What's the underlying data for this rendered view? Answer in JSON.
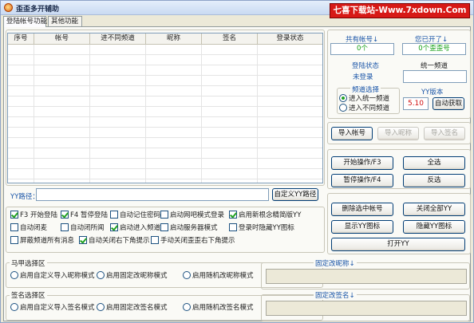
{
  "window": {
    "title": "歪歪多开辅助",
    "watermark": "七喜下载站-Www.7xdown.Com"
  },
  "tabs": [
    {
      "label": "登陆帐号功能"
    },
    {
      "label": "其他功能"
    }
  ],
  "grid": {
    "columns": [
      "序号",
      "帐号",
      "进不同频道",
      "昵称",
      "签名",
      "登录状态"
    ]
  },
  "yy_path": {
    "label": "YY路径：",
    "value": "",
    "button": "自定义YY路径"
  },
  "stats": {
    "total_label": "共有帐号↓",
    "total_value": "0个",
    "opened_label": "您已开了↓",
    "opened_value": "0个歪歪号",
    "login_status_label": "登陆状态",
    "login_status_value": "未登录",
    "channel_label": "统一频道",
    "channel_value": "",
    "channel_select_label": "频道选择",
    "channel_options": [
      {
        "label": "进入统一频道",
        "checked": true
      },
      {
        "label": "进入不同频道",
        "checked": false
      }
    ],
    "yy_version_label": "YY版本",
    "yy_version_value": "5.10",
    "auto_fetch": "自动获取"
  },
  "import": {
    "account": "导入帐号",
    "nickname": "导入昵称",
    "signature": "导入签名"
  },
  "ops": {
    "start": "开始操作/F3",
    "select_all": "全选",
    "pause": "暂停操作/F4",
    "invert": "反选"
  },
  "actions": {
    "delete_selected": "删除选中帐号",
    "close_all": "关闭全部YY",
    "show_icon": "显示YY图标",
    "hide_icon": "隐藏YY图标",
    "open": "打开YY"
  },
  "options": [
    {
      "label": "F3 开始登陆",
      "checked": true
    },
    {
      "label": "F4 暂停登陆",
      "checked": true
    },
    {
      "label": "自动记住密码",
      "checked": false
    },
    {
      "label": "启动网吧模式登录",
      "checked": false
    },
    {
      "label": "启用新根念精简版YY",
      "checked": true
    },
    {
      "label": "自动闭麦",
      "checked": false
    },
    {
      "label": "自动闭所闻",
      "checked": false
    },
    {
      "label": "启动进入频道",
      "checked": true
    },
    {
      "label": "启动服务器模式",
      "checked": false
    },
    {
      "label": "登录时隐藏YY图标",
      "checked": false
    },
    {
      "label": "屏蔽频道所有消息",
      "checked": false
    },
    {
      "label": "自动关闭右下角提示",
      "checked": true
    },
    {
      "label": "手动关闭歪歪右下角提示",
      "checked": false
    }
  ],
  "vest": {
    "title": "马甲选择区",
    "fixed_label": "固定改昵称↓",
    "fixed_value": "",
    "options": [
      {
        "label": "启用自定义导入昵称模式",
        "checked": false
      },
      {
        "label": "启用固定改昵称模式",
        "checked": false
      },
      {
        "label": "启用随机改昵称模式",
        "checked": false
      }
    ]
  },
  "sign": {
    "title": "签名选择区",
    "fixed_label": "固定改签名↓",
    "fixed_value": "",
    "options": [
      {
        "label": "启用自定义导入签名模式",
        "checked": false
      },
      {
        "label": "启用固定改签名模式",
        "checked": false
      },
      {
        "label": "启用随机改签名模式",
        "checked": false
      }
    ]
  }
}
